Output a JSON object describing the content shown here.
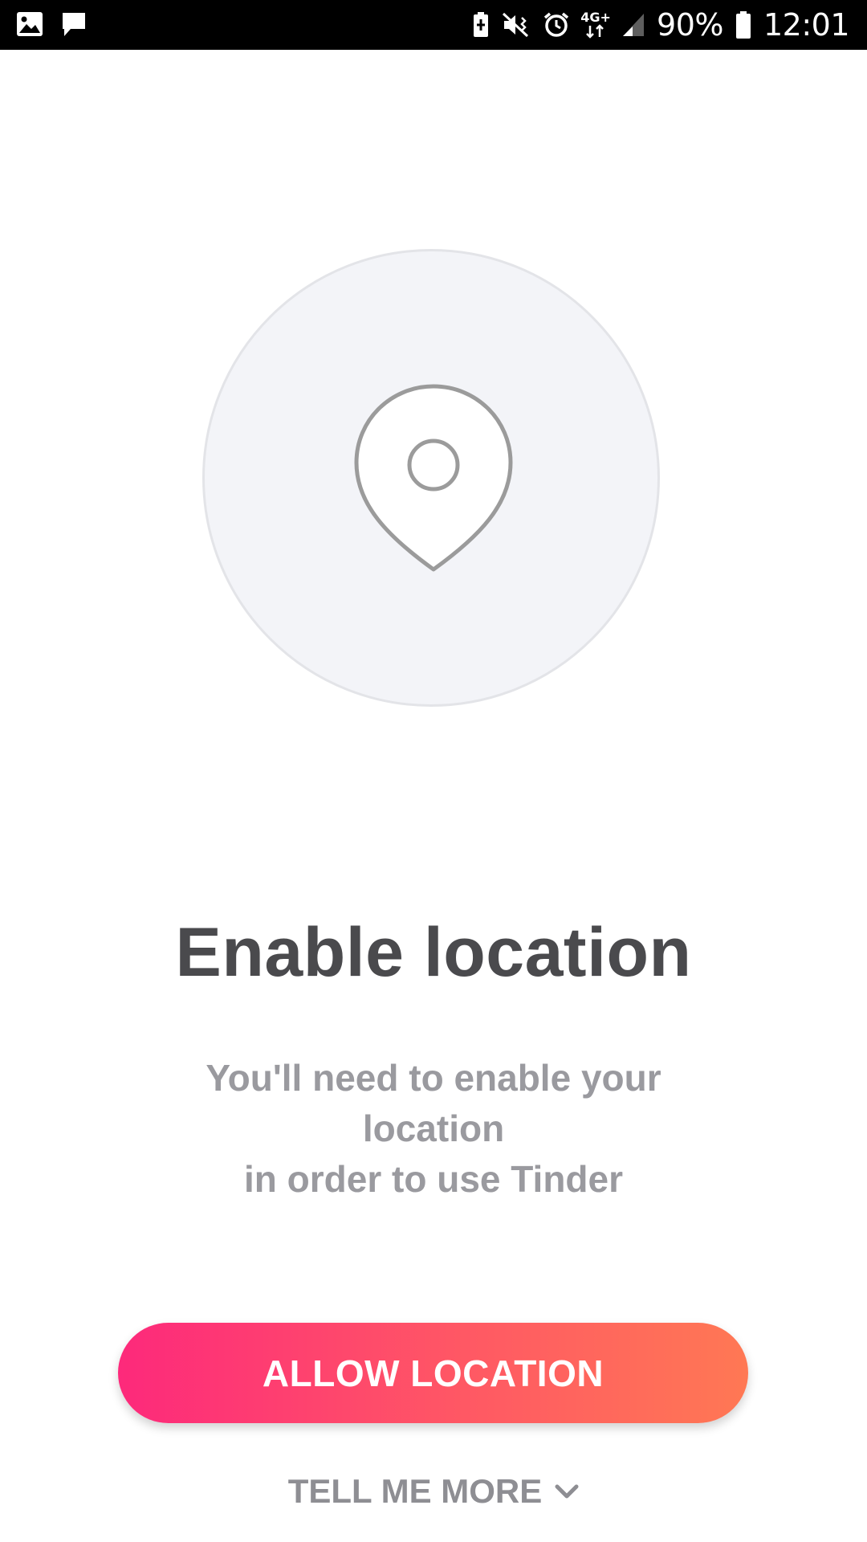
{
  "status_bar": {
    "left_icons": [
      "gallery-icon",
      "message-icon"
    ],
    "right_icons": [
      "battery-saver-icon",
      "vibrate-mute-icon",
      "alarm-icon",
      "network-4g-plus-icon",
      "signal-icon",
      "battery-icon"
    ],
    "network_label": "4G+",
    "battery_percent": "90%",
    "time": "12:01"
  },
  "illustration": {
    "icon": "location-pin-icon",
    "circle_color": "#f3f4f8",
    "icon_color": "#9b9b9b"
  },
  "main": {
    "title": "Enable location",
    "description_lines": [
      "You'll need to enable your",
      "location",
      "in order to use Tinder"
    ]
  },
  "actions": {
    "allow_label": "ALLOW LOCATION",
    "allow_gradient": [
      "#fd297b",
      "#ff5864",
      "#ff7854"
    ],
    "tell_more_label": "TELL ME MORE",
    "tell_more_icon": "chevron-down-icon"
  }
}
